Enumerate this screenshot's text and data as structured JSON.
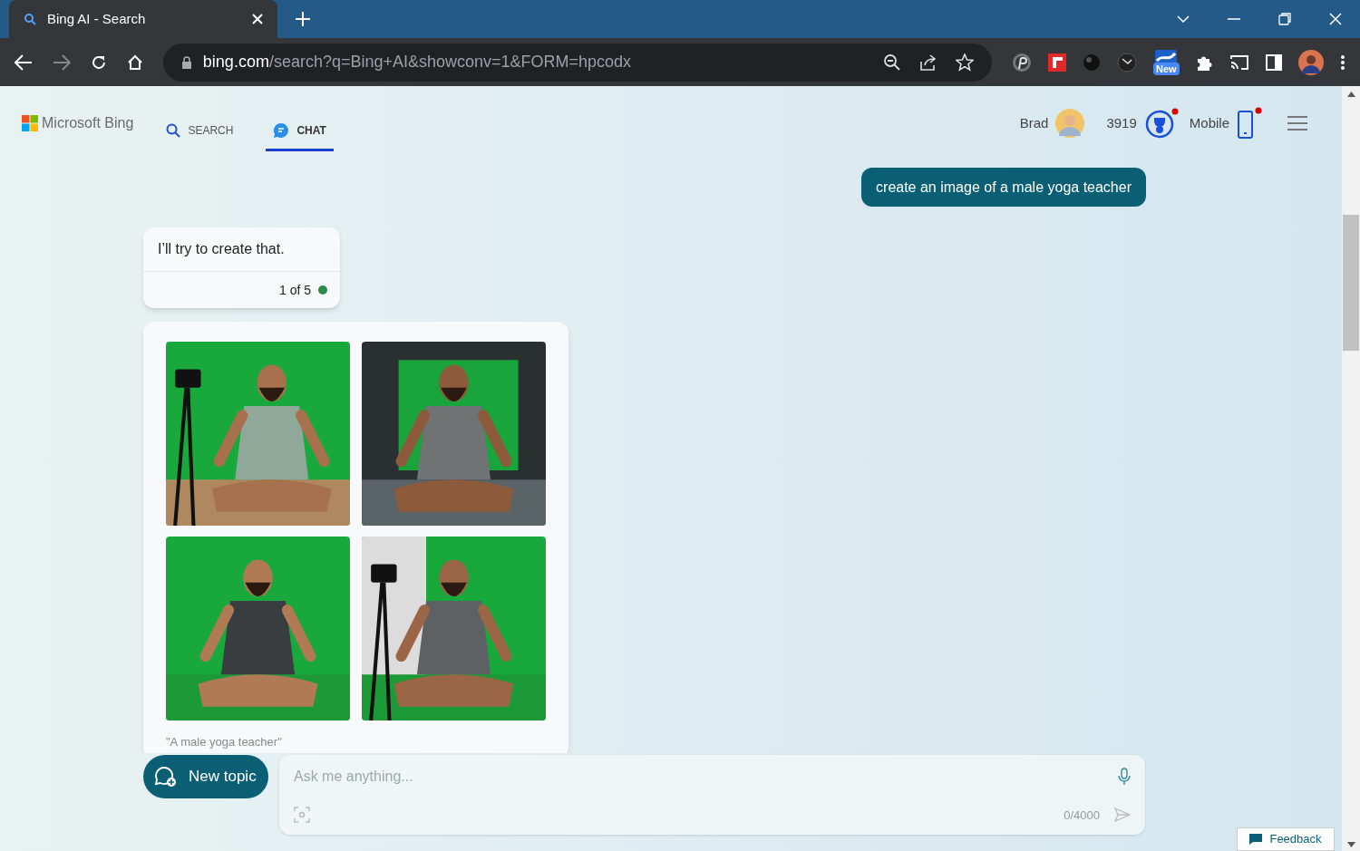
{
  "browser": {
    "tab_title": "Bing AI - Search",
    "url_host": "bing.com",
    "url_path": "/search?q=Bing+AI&showconv=1&FORM=hpcodx",
    "extension_badge": "New"
  },
  "header": {
    "logo": "Microsoft Bing",
    "nav": [
      {
        "label": "SEARCH",
        "selected": false
      },
      {
        "label": "CHAT",
        "selected": true
      }
    ],
    "user_name": "Brad",
    "points": "3919",
    "mobile": "Mobile"
  },
  "user_message": "create an image of a male yoga teacher",
  "bot_message": {
    "text": "I’ll try to create that.",
    "counter": "1 of 5"
  },
  "image_card": {
    "caption": "\"A male yoga teacher\""
  },
  "composer": {
    "new_topic": "New topic",
    "placeholder": "Ask me anything...",
    "char_count": "0/4000"
  },
  "feedback": "Feedback"
}
